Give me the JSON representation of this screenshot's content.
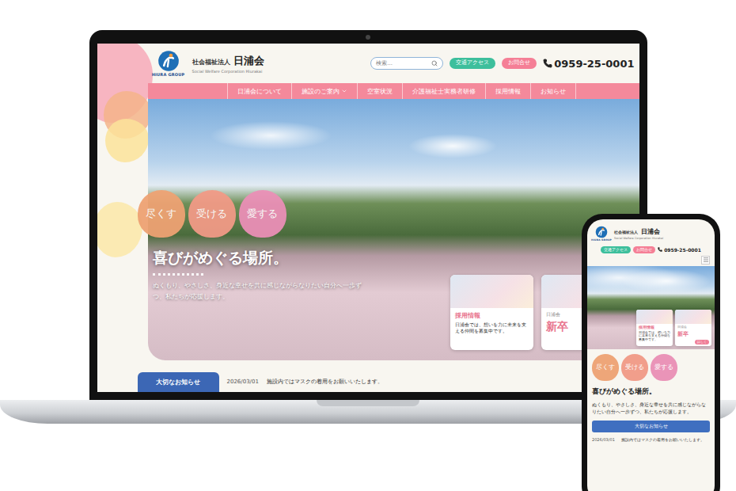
{
  "site": {
    "logo_text": "HIURA GROUP",
    "org_type": "社会福祉法人",
    "name": "日浦会",
    "name_en": "Social Welfare Corporation Hiurakai"
  },
  "search": {
    "placeholder": "検索..."
  },
  "header_buttons": [
    {
      "label": "交通アクセス",
      "color": "#3dbf9c"
    },
    {
      "label": "お問合せ",
      "color": "#f57f96"
    }
  ],
  "phone": "0959-25-0001",
  "nav": [
    {
      "label": "日浦会について",
      "has_menu": false
    },
    {
      "label": "施設のご案内",
      "has_menu": true
    },
    {
      "label": "空室状況",
      "has_menu": false
    },
    {
      "label": "介護福祉士実務者研修",
      "has_menu": false
    },
    {
      "label": "採用情報",
      "has_menu": false
    },
    {
      "label": "お知らせ",
      "has_menu": false
    }
  ],
  "hero": {
    "values": [
      {
        "label": "尽くす",
        "color": "#eea273"
      },
      {
        "label": "受ける",
        "color": "#f19a86"
      },
      {
        "label": "愛する",
        "color": "#ea8fb6"
      }
    ],
    "title": "喜びがめぐる場所。",
    "subtitle": "ぬくもり、やさしさ、身近な幸せを共に感じながらなりたい自分へ一歩ずつ、私たちが応援します。"
  },
  "cards": [
    {
      "kind": "info",
      "title": "採用情報",
      "text": "日浦会では、想いを力に未来を支える仲間を募集中です。"
    },
    {
      "kind": "promo",
      "label": "日浦会",
      "title": "新卒",
      "button": "詳しく"
    }
  ],
  "notice": {
    "label": "大切なお知らせ",
    "date": "2026/03/01",
    "text": "施設内ではマスクの着用をお願いいたします。"
  }
}
